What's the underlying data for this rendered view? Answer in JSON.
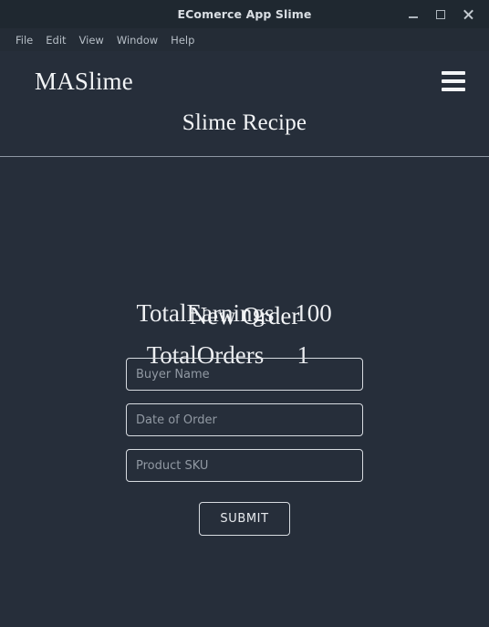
{
  "window": {
    "title": "EComerce App Slime",
    "controls": {
      "minimize": "minimize",
      "maximize": "maximize",
      "close": "close"
    }
  },
  "menubar": {
    "items": [
      {
        "label": "File"
      },
      {
        "label": "Edit"
      },
      {
        "label": "View"
      },
      {
        "label": "Window"
      },
      {
        "label": "Help"
      }
    ]
  },
  "header": {
    "brand": "MASlime",
    "page_title": "Slime Recipe",
    "menu_icon": "hamburger-icon"
  },
  "stats": {
    "rows": [
      {
        "label": "TotalEarnings",
        "value": "100"
      },
      {
        "label": "TotalOrders",
        "value": "1"
      }
    ]
  },
  "form": {
    "title": "New Order",
    "fields": [
      {
        "name": "buyer-name",
        "placeholder": "Buyer Name",
        "value": ""
      },
      {
        "name": "date-of-order",
        "placeholder": "Date of Order",
        "value": ""
      },
      {
        "name": "product-sku",
        "placeholder": "Product SKU",
        "value": ""
      }
    ],
    "submit_label": "SUBMIT"
  },
  "colors": {
    "titlebar_bg": "#1F2830",
    "menubar_bg": "#242C36",
    "app_bg": "#262E3A",
    "text_primary": "#F2F4F6",
    "text_muted": "#9199A3",
    "border": "#D7DBE0"
  }
}
